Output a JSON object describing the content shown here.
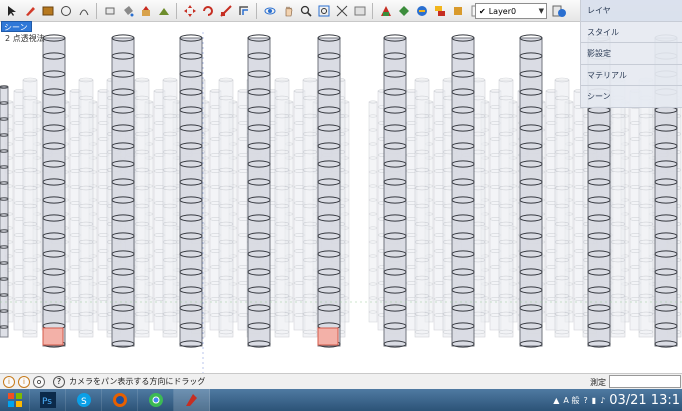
{
  "toolbar": {
    "layer_select": "Layer0",
    "tools": [
      "select-icon",
      "pencil-icon",
      "rectangle-icon",
      "circle-icon",
      "arc-icon",
      "eraser-icon",
      "paint-bucket-icon",
      "push-pull-icon",
      "move-icon",
      "rotate-icon",
      "offset-icon",
      "orbit-icon",
      "pan-icon",
      "zoom-icon",
      "zoom-extents-icon",
      "previous-view-icon",
      "warehouse-icon",
      "share-model-icon",
      "extension-icon",
      "layer-manager-icon"
    ]
  },
  "scene_tab": "シーン 1",
  "view_label": "2 点透視法",
  "tray": {
    "items": [
      "レイヤ",
      "スタイル",
      "影設定",
      "マテリアル",
      "シーン"
    ]
  },
  "status": {
    "text": "カメラをパン表示する方向にドラッグ",
    "measure_label": "測定"
  },
  "taskbar": {
    "apps": [
      "start-icon",
      "photoshop-icon",
      "skype-icon",
      "firefox-icon",
      "chrome-icon",
      "sketchup-icon"
    ],
    "lang": "A 般",
    "clock": "03/21 13:1"
  },
  "colors": {
    "accent": "#2f78d8",
    "highlight_square": "#f3b1a8",
    "taskbar": "#3c6b93"
  }
}
